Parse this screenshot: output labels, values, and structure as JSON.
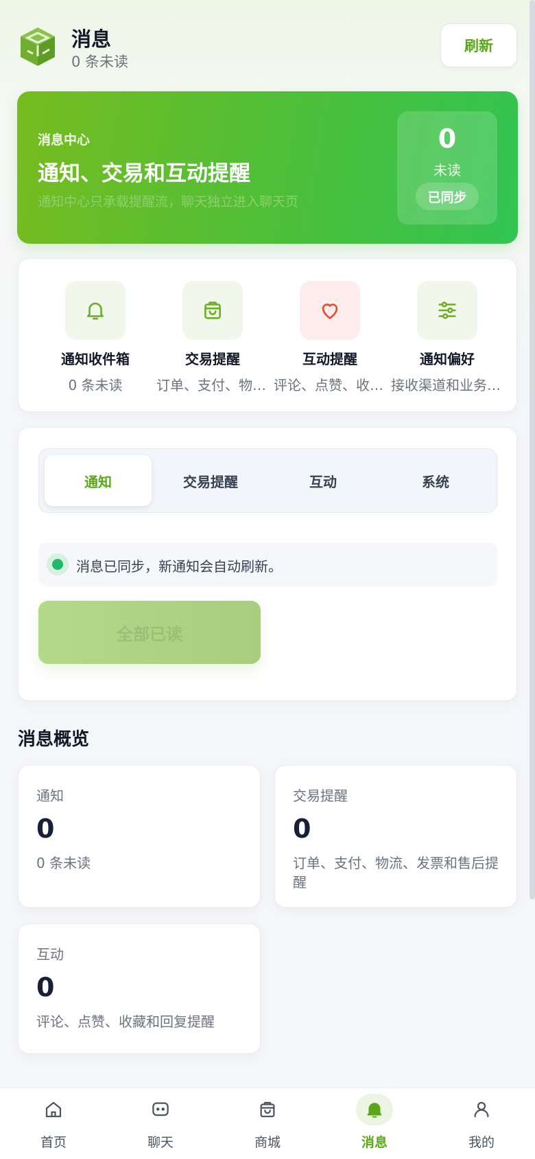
{
  "header": {
    "title": "消息",
    "subtitle": "0 条未读",
    "refresh_label": "刷新",
    "logo_icon": "green-cube-logo"
  },
  "hero": {
    "kicker": "消息中心",
    "title": "通知、交易和互动提醒",
    "description": "通知中心只承载提醒流，聊天独立进入聊天页",
    "unread_count": "0",
    "unread_label": "未读",
    "sync_badge": "已同步"
  },
  "quick_entries": [
    {
      "label": "通知收件箱",
      "sub": "0 条未读",
      "icon": "bell-icon"
    },
    {
      "label": "交易提醒",
      "sub": "订单、支付、物流、发票和售后提醒",
      "icon": "shopping-bag-icon"
    },
    {
      "label": "互动提醒",
      "sub": "评论、点赞、收藏和回复提醒",
      "icon": "heart-icon"
    },
    {
      "label": "通知偏好",
      "sub": "接收渠道和业务提醒设置",
      "icon": "sliders-icon"
    }
  ],
  "tabs": [
    {
      "label": "通知",
      "active": true
    },
    {
      "label": "交易提醒",
      "active": false
    },
    {
      "label": "互动",
      "active": false
    },
    {
      "label": "系统",
      "active": false
    }
  ],
  "status_text": "消息已同步，新通知会自动刷新。",
  "read_all_label": "全部已读",
  "overview": {
    "title": "消息概览",
    "cards": [
      {
        "label": "通知",
        "count": "0",
        "desc": "0 条未读"
      },
      {
        "label": "交易提醒",
        "count": "0",
        "desc": "订单、支付、物流、发票和售后提醒"
      },
      {
        "label": "互动",
        "count": "0",
        "desc": "评论、点赞、收藏和回复提醒"
      }
    ]
  },
  "bottom_nav": [
    {
      "label": "首页",
      "icon": "home-icon",
      "active": false
    },
    {
      "label": "聊天",
      "icon": "chat-icon",
      "active": false
    },
    {
      "label": "商城",
      "icon": "shopping-bag-icon",
      "active": false
    },
    {
      "label": "消息",
      "icon": "bell-icon",
      "active": true
    },
    {
      "label": "我的",
      "icon": "user-icon",
      "active": false
    }
  ],
  "colors": {
    "accent": "#5aa81a",
    "hero_start": "#77bc1f",
    "hero_end": "#32c553",
    "status_green": "#22b86a"
  }
}
